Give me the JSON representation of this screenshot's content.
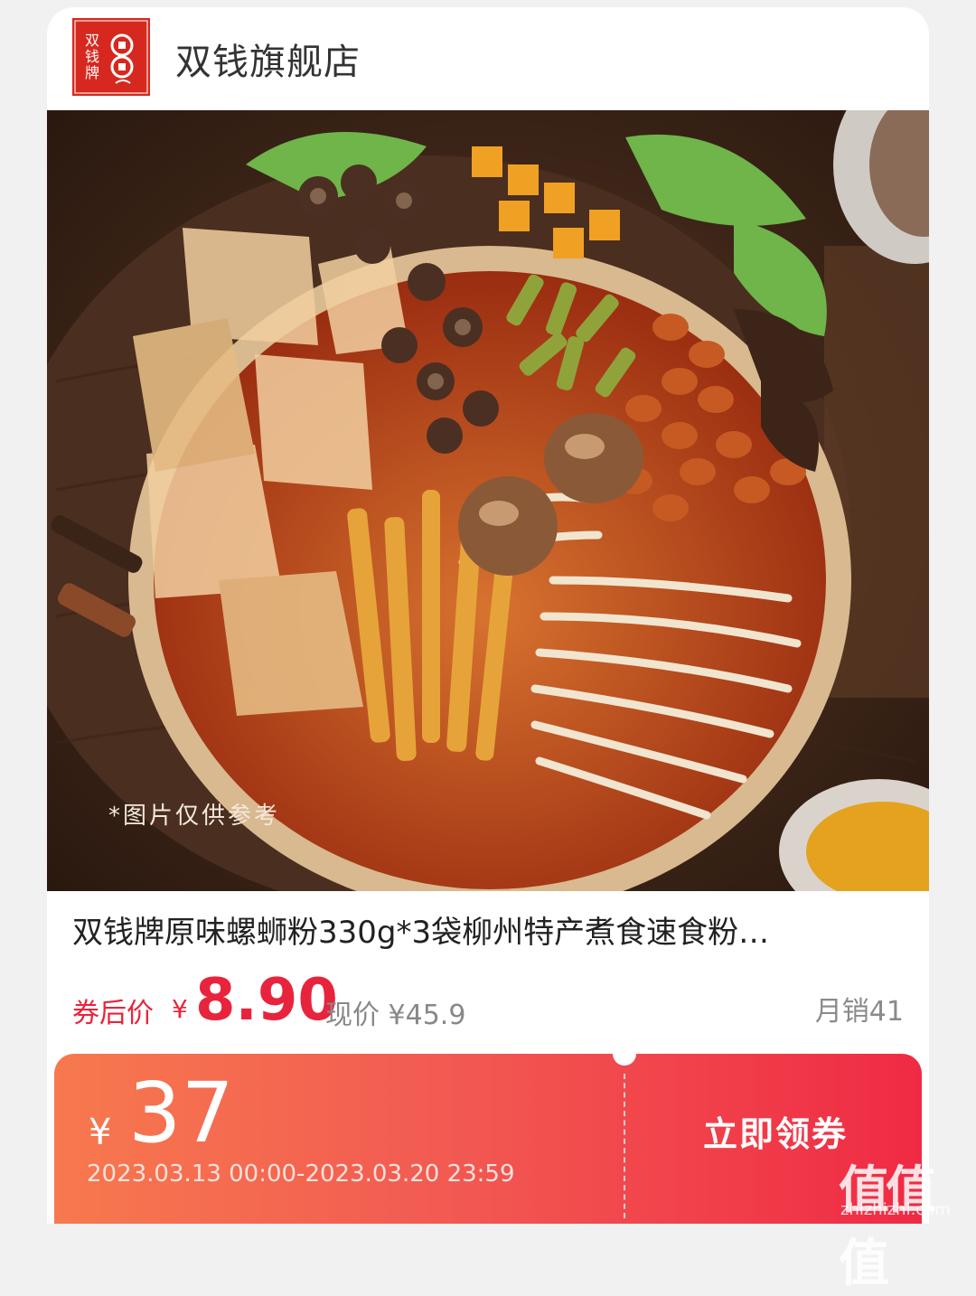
{
  "store": {
    "name": "双钱旗舰店"
  },
  "product": {
    "image_caption": "*图片仅供参考",
    "title": "双钱牌原味螺蛳粉330g*3袋柳州特产煮食速食粉…",
    "coupon_price_label": "券后价",
    "currency": "¥",
    "coupon_price": "8.90",
    "current_price_label": "现价 ¥45.9",
    "monthly_sales": "月销41"
  },
  "coupon": {
    "currency": "¥",
    "amount": "37",
    "validity": "2023.03.13 00:00-2023.03.20 23:59",
    "claim_label": "立即领券"
  },
  "watermark": {
    "text": "值值值",
    "url": "zhizhizhi.com"
  },
  "colors": {
    "accent": "#e8243c",
    "coupon_gradient_start": "#f7794e",
    "coupon_gradient_end": "#f02a44",
    "logo_red": "#d7281f"
  }
}
